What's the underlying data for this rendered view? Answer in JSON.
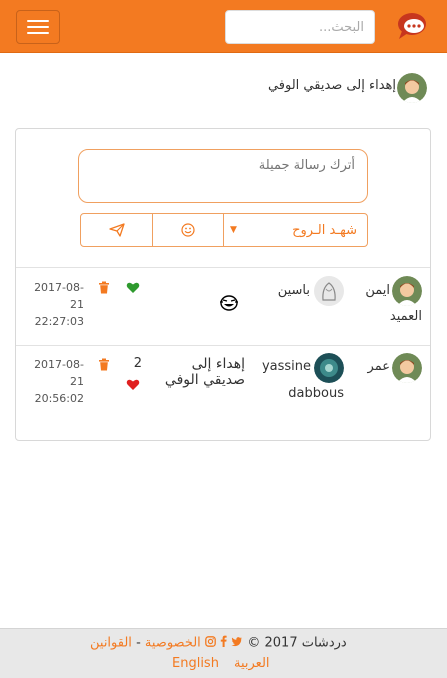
{
  "header": {
    "search_placeholder": "البحث...",
    "brand_color": "#f37a21",
    "menu_icon": "hamburger-icon",
    "logo_icon": "chat-bubbles-icon"
  },
  "dedication": {
    "title": "إهداء إلى صديقي الوفي"
  },
  "composer": {
    "message_placeholder": "أترك رسالة جميلة",
    "select_value": "شهـد الـروح",
    "send_icon": "paper-plane-icon",
    "emoji_icon": "smiley-icon"
  },
  "messages": [
    {
      "sender": "ايمن",
      "sender_line2": "العميد",
      "receiver": "باسين",
      "body_icon": "laughing-emoji-icon",
      "count": "",
      "liked": true,
      "like_color": "#2e9a2e",
      "date_line1": "2017-08-",
      "date_line2": "21",
      "time": "22:27:03"
    },
    {
      "sender": "عمر",
      "receiver": "yassine",
      "receiver_line2": "dabbous",
      "body_line1": "إهداء إلى",
      "body_line2": "صديقي الوفي",
      "count": "2",
      "liked": true,
      "like_color": "#e02020",
      "date_line1": "2017-08-",
      "date_line2": "21",
      "time": "20:56:02"
    }
  ],
  "footer": {
    "brand": "دردشات 2017 ©",
    "privacy": "الخصوصية",
    "sep": "-",
    "rules": "القوانين",
    "lang_ar": "العربية",
    "lang_en": "English"
  }
}
